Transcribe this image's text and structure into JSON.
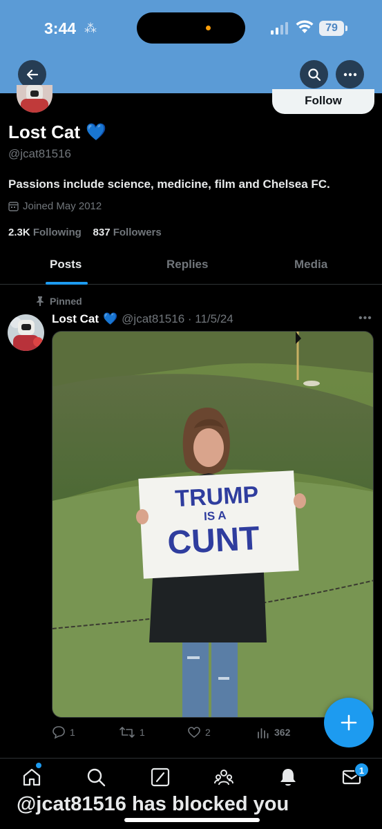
{
  "status_bar": {
    "time": "3:44",
    "battery": "79"
  },
  "profile": {
    "display_name": "Lost Cat",
    "verified_emoji": "💙",
    "handle": "@jcat81516",
    "bio": "Passions include science, medicine, film and Chelsea FC.",
    "joined": "Joined May 2012",
    "following_count": "2.3K",
    "following_label": "Following",
    "followers_count": "837",
    "followers_label": "Followers",
    "follow_button": "Follow"
  },
  "tabs": [
    {
      "label": "Posts",
      "active": true
    },
    {
      "label": "Replies",
      "active": false
    },
    {
      "label": "Media",
      "active": false
    }
  ],
  "post": {
    "pinned_label": "Pinned",
    "author_name": "Lost Cat",
    "author_emoji": "💙",
    "meta": "@jcat81516 · 11/5/24",
    "sign_text": [
      "TRUMP",
      "IS A",
      "CUNT"
    ],
    "replies": "1",
    "reposts": "1",
    "likes": "2",
    "views": "362"
  },
  "bottom_nav": {
    "messages_badge": "1"
  },
  "overlay_caption": "@jcat81516 has blocked you",
  "colors": {
    "banner": "#5b9bd6",
    "accent": "#1d9bf0",
    "background": "#000000",
    "muted_text": "#71767b"
  }
}
